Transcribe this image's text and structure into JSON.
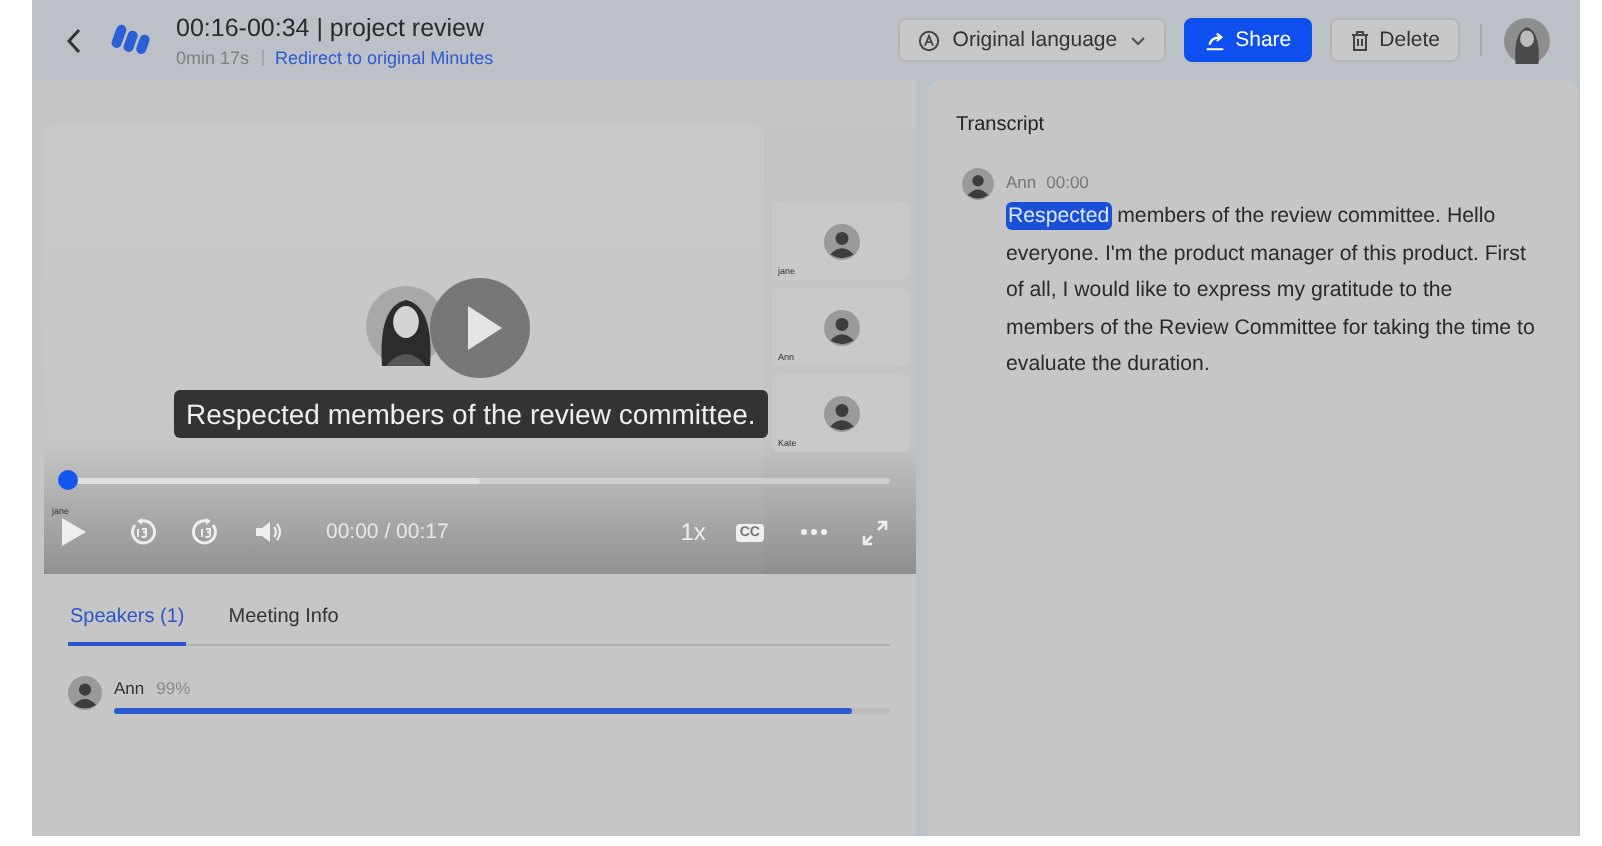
{
  "header": {
    "title": "00:16-00:34 | project review",
    "duration": "0min 17s",
    "link": "Redirect to original Minutes",
    "buttons": [
      {
        "kind": "dropdown",
        "label": "Original language"
      },
      {
        "kind": "primary",
        "label": "Share"
      },
      {
        "kind": "delete",
        "label": "Delete"
      }
    ]
  },
  "player": {
    "speaker_tag": "jane",
    "thumbnails": [
      {
        "name": "jane"
      },
      {
        "name": "Ann"
      },
      {
        "name": "Kate"
      }
    ],
    "caption": "Respected members of the review committee.",
    "level": 0,
    "time": "00:00 / 00:17",
    "speed": "1x",
    "cc": "CC"
  },
  "tabs": [
    {
      "label": "Speakers (1)",
      "selected": true
    },
    {
      "label": "Meeting Info",
      "selected": false
    }
  ],
  "speakers": [
    {
      "name": "Ann",
      "share": "99%",
      "level": 0.95
    }
  ],
  "transcript": {
    "title": "Transcript",
    "entries": [
      {
        "speaker": "Ann",
        "time": "00:00",
        "segments": [
          {
            "text": "Respected",
            "highlighted": true
          },
          {
            "text": " members of the review committee. Hello everyone. I'm the product manager of this product. First of all, I would like to express my gratitude to the members of the Review Committee for taking the time to evaluate the duration.",
            "highlighted": false
          }
        ]
      }
    ]
  }
}
